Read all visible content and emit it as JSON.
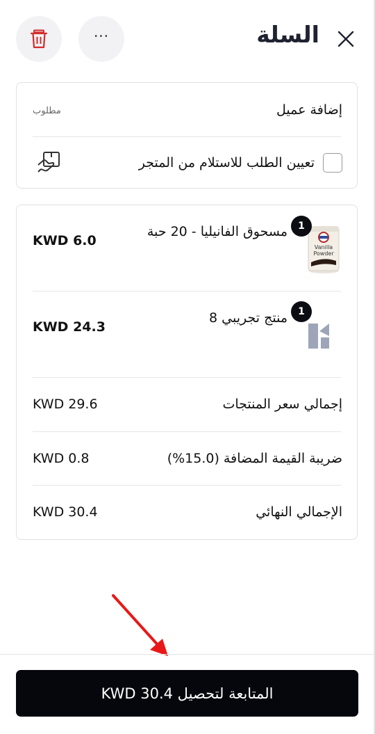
{
  "header": {
    "title": "السلة",
    "close_icon": "close-icon",
    "more_icon": "more-horizontal-icon",
    "more_glyph": "···",
    "delete_icon": "trash-icon"
  },
  "customer": {
    "add_label": "إضافة عميل",
    "required_label": "مطلوب",
    "pickup_label": "تعيين الطلب للاستلام من المتجر",
    "pickup_checked": false,
    "pickup_icon": "store-pickup-icon"
  },
  "cart": {
    "items": [
      {
        "name": "مسحوق الفانيليا - 20 حبة",
        "qty": "1",
        "price": "KWD 6.0",
        "thumb": "vanilla-powder-product-image"
      },
      {
        "name": "منتج تجريبي 8",
        "qty": "1",
        "price": "KWD 24.3",
        "thumb": "placeholder-product-logo"
      }
    ],
    "summary": [
      {
        "label": "إجمالي سعر المنتجات",
        "value": "KWD 29.6"
      },
      {
        "label": "ضريبة القيمة المضافة (15.0%)",
        "value": "KWD 0.8"
      },
      {
        "label": "الإجمالي النهائي",
        "value": "KWD 30.4"
      }
    ]
  },
  "checkout": {
    "label": "المتابعة لتحصيل KWD 30.4"
  },
  "colors": {
    "primary": "#05070c",
    "danger": "#d22b2b",
    "annotation": "#e81818"
  }
}
